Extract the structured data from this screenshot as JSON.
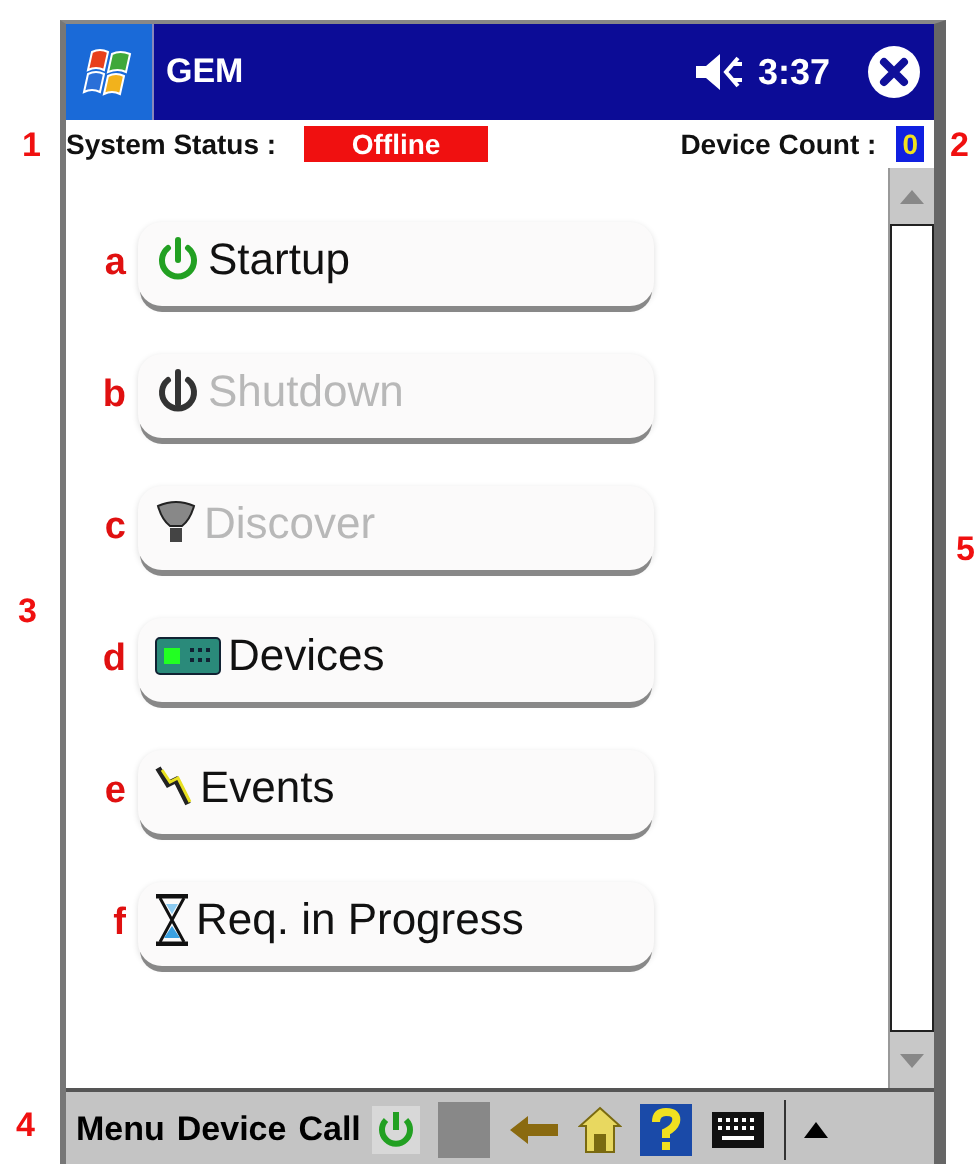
{
  "annotations": [
    {
      "label": "1"
    },
    {
      "label": "2"
    },
    {
      "label": "5"
    },
    {
      "label": "3"
    },
    {
      "label": "4"
    }
  ],
  "title_bar": {
    "title": "GEM",
    "time": "3:37"
  },
  "status": {
    "label": "System Status :",
    "value": "Offline",
    "count_label": "Device Count :",
    "count": "0"
  },
  "buttons": [
    {
      "marker": "a",
      "label": "Startup",
      "kind": "power",
      "disabled": false
    },
    {
      "marker": "b",
      "label": "Shutdown",
      "kind": "power-off",
      "disabled": true
    },
    {
      "marker": "c",
      "label": "Discover",
      "kind": "bulb",
      "disabled": true
    },
    {
      "marker": "d",
      "label": "Devices",
      "kind": "device",
      "disabled": false
    },
    {
      "marker": "e",
      "label": "Events",
      "kind": "lightning",
      "disabled": false
    },
    {
      "marker": "f",
      "label": "Req. in Progress",
      "kind": "hourglass",
      "disabled": false
    }
  ],
  "menu_bar": {
    "items": [
      "Menu",
      "Device",
      "Call"
    ]
  }
}
